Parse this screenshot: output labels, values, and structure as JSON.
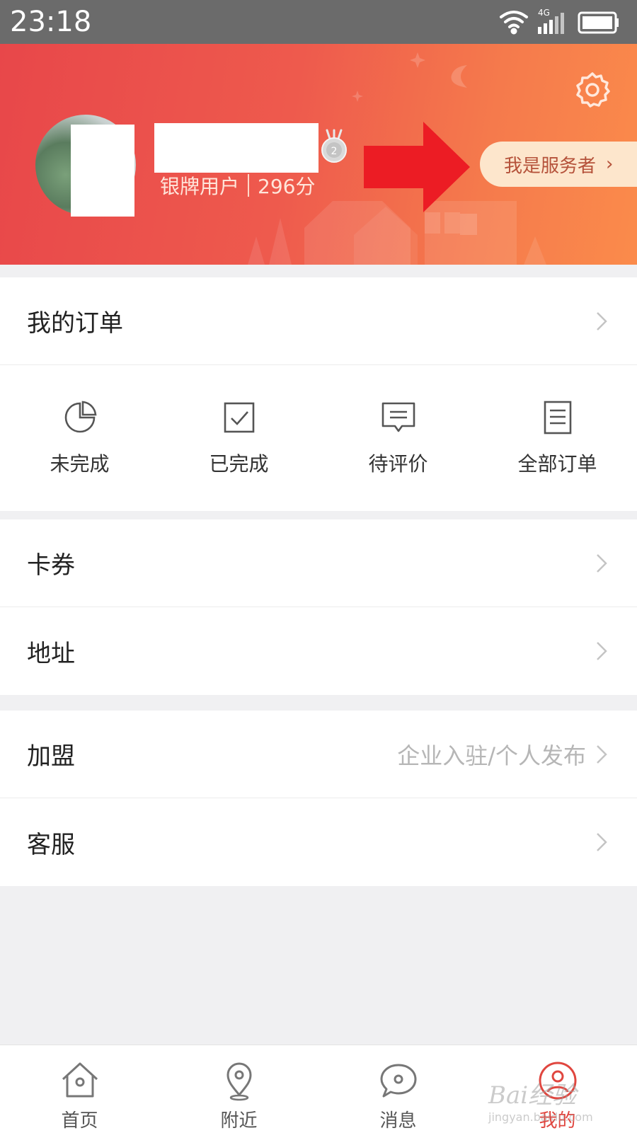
{
  "status_bar": {
    "time": "23:18",
    "network": "4G"
  },
  "profile": {
    "level": "银牌用户",
    "points": "296分",
    "medal_icon": "silver-medal-icon",
    "service_provider_button": "我是服务者"
  },
  "orders": {
    "title": "我的订单",
    "items": [
      {
        "label": "未完成",
        "icon": "pie-clock-icon"
      },
      {
        "label": "已完成",
        "icon": "checkbox-icon"
      },
      {
        "label": "待评价",
        "icon": "comment-icon"
      },
      {
        "label": "全部订单",
        "icon": "list-document-icon"
      }
    ]
  },
  "menu": {
    "coupons": "卡券",
    "address": "地址",
    "franchise": {
      "label": "加盟",
      "hint": "企业入驻/个人发布"
    },
    "service": "客服"
  },
  "tabbar": [
    {
      "label": "首页",
      "icon": "home-icon"
    },
    {
      "label": "附近",
      "icon": "location-pin-icon"
    },
    {
      "label": "消息",
      "icon": "chat-bubble-icon"
    },
    {
      "label": "我的",
      "icon": "user-icon",
      "active": true
    }
  ],
  "watermark": {
    "main": "Bai经验",
    "sub": "jingyan.baidu.com"
  },
  "colors": {
    "accent": "#e0463f",
    "header_start": "#e8474a",
    "header_end": "#fb8b4b",
    "annotation_arrow": "#ec1c24"
  }
}
